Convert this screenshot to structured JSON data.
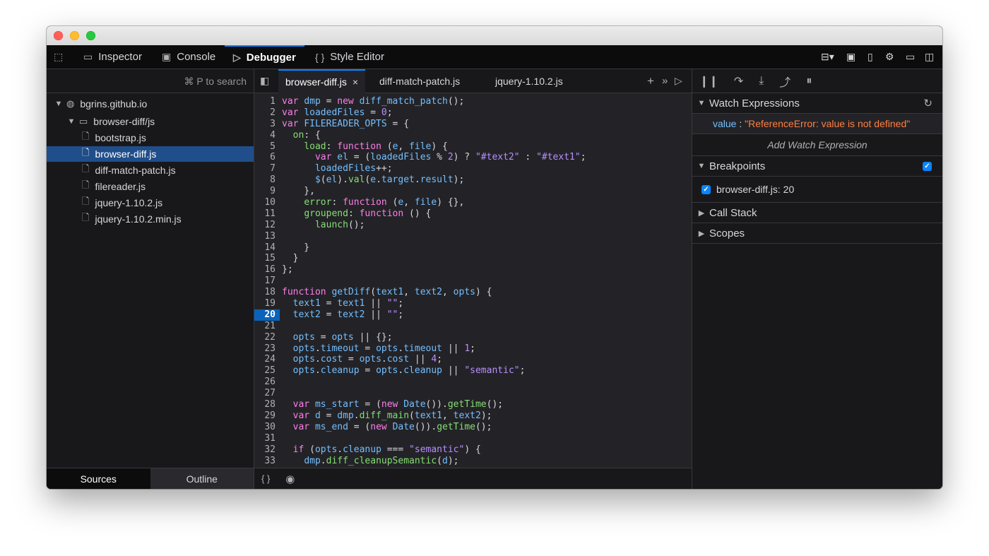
{
  "toolbar": {
    "tabs": [
      {
        "label": "Inspector",
        "icon": "inspector-icon"
      },
      {
        "label": "Console",
        "icon": "console-icon"
      },
      {
        "label": "Debugger",
        "icon": "debugger-icon"
      },
      {
        "label": "Style Editor",
        "icon": "style-editor-icon"
      }
    ]
  },
  "sources": {
    "search_hint": "⌘ P to search",
    "root": "bgrins.github.io",
    "folder": "browser-diff/js",
    "files": [
      "bootstrap.js",
      "browser-diff.js",
      "diff-match-patch.js",
      "filereader.js",
      "jquery-1.10.2.js",
      "jquery-1.10.2.min.js"
    ],
    "selected_index": 1,
    "bottom_tabs": {
      "sources": "Sources",
      "outline": "Outline"
    }
  },
  "editor": {
    "tabs": [
      "browser-diff.js",
      "diff-match-patch.js",
      "jquery-1.10.2.js"
    ],
    "active_tab": 0,
    "breakpoint_line": 20
  },
  "right": {
    "watch_title": "Watch Expressions",
    "watch_name": "value",
    "watch_sep": " : ",
    "watch_value": "\"ReferenceError: value is not defined\"",
    "add_watch": "Add Watch Expression",
    "breakpoints_title": "Breakpoints",
    "breakpoint_item": "browser-diff.js: 20",
    "call_stack_title": "Call Stack",
    "scopes_title": "Scopes"
  },
  "colors": {
    "accent": "#0a84ff",
    "selection": "#204e8a",
    "error": "#ff7f3f"
  }
}
